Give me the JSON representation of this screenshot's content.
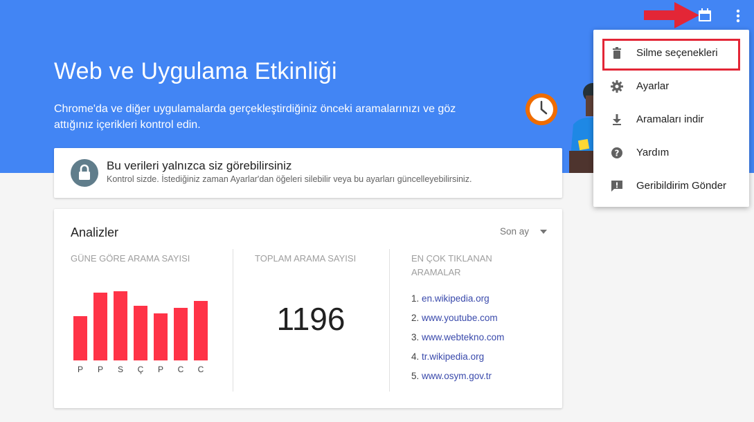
{
  "hero": {
    "title": "Web ve Uygulama Etkinliği",
    "description": "Chrome'da ve diğer uygulamalarda gerçekleştirdiğiniz önceki aramalarınızı ve göz attığınız içerikleri kontrol edin."
  },
  "privacy": {
    "title": "Bu verileri yalnızca siz görebilirsiniz",
    "subtitle": "Kontrol sizde. İstediğiniz zaman Ayarlar'dan öğeleri silebilir veya bu ayarları güncelleyebilirsiniz."
  },
  "analytics": {
    "title": "Analizler",
    "range": "Son ay",
    "daily": {
      "heading": "GÜNE GÖRE ARAMA SAYISI",
      "days": [
        "P",
        "P",
        "S",
        "Ç",
        "P",
        "C",
        "C"
      ],
      "values": [
        64,
        98,
        100,
        79,
        68,
        76,
        86
      ]
    },
    "total": {
      "heading": "TOPLAM ARAMA SAYISI",
      "value": "1196"
    },
    "top": {
      "heading_line1": "EN ÇOK TIKLANAN",
      "heading_line2": "ARAMALAR",
      "items": [
        {
          "num": "1.",
          "site": "en.wikipedia.org"
        },
        {
          "num": "2.",
          "site": "www.youtube.com"
        },
        {
          "num": "3.",
          "site": "www.webtekno.com"
        },
        {
          "num": "4.",
          "site": "tr.wikipedia.org"
        },
        {
          "num": "5.",
          "site": "www.osym.gov.tr"
        }
      ]
    }
  },
  "menu": {
    "items": [
      {
        "label": "Silme seçenekleri",
        "icon": "trash-icon"
      },
      {
        "label": "Ayarlar",
        "icon": "gear-icon"
      },
      {
        "label": "Aramaları indir",
        "icon": "download-icon"
      },
      {
        "label": "Yardım",
        "icon": "help-icon"
      },
      {
        "label": "Geribildirim Gönder",
        "icon": "feedback-icon"
      }
    ]
  },
  "colors": {
    "brand_blue": "#4285f4",
    "bar_red": "#ff3347",
    "annotation_red": "#e32636",
    "link": "#3949ab"
  }
}
